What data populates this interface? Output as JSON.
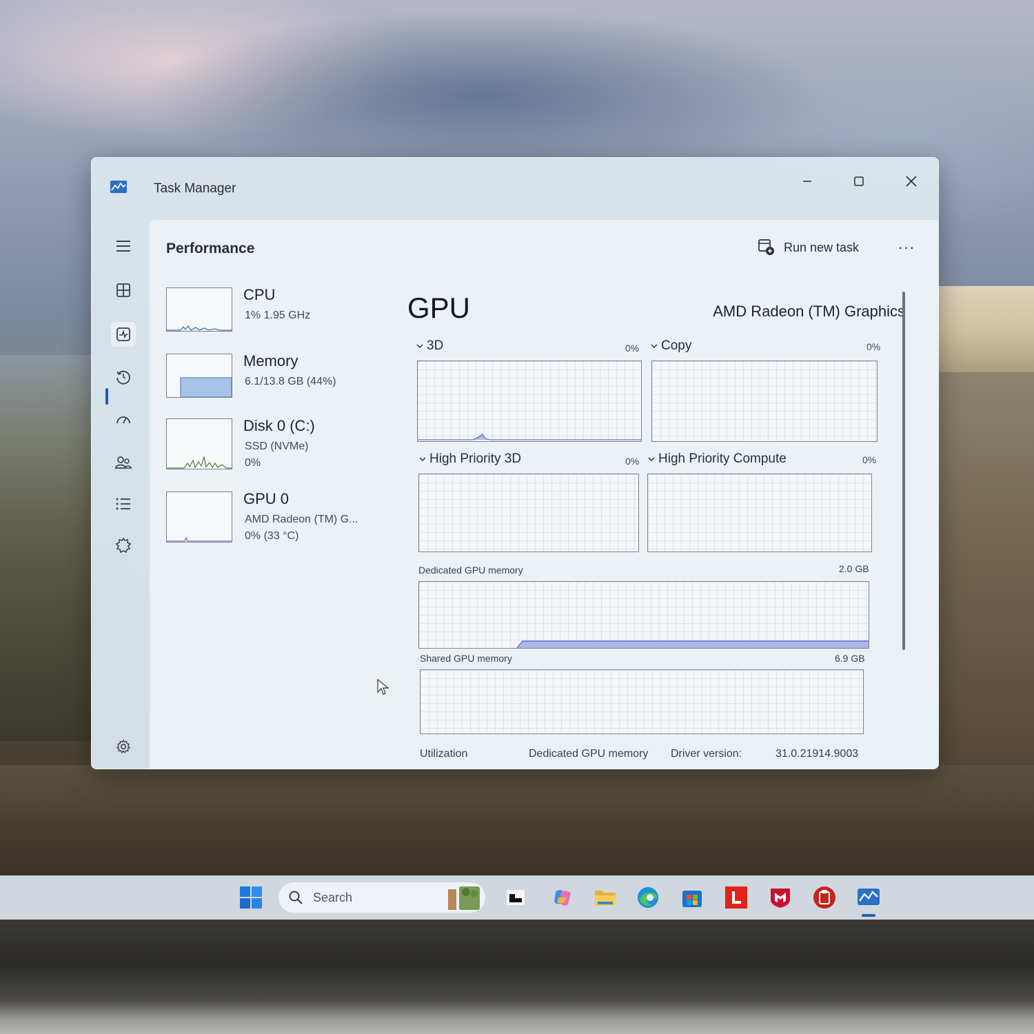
{
  "window": {
    "title": "Task Manager",
    "minimize_label": "",
    "maximize_label": "",
    "close_label": ""
  },
  "nav": {
    "items": [
      {
        "name": "menu-icon"
      },
      {
        "name": "processes-icon"
      },
      {
        "name": "performance-icon",
        "active": true
      },
      {
        "name": "app-history-icon"
      },
      {
        "name": "startup-apps-icon"
      },
      {
        "name": "users-icon"
      },
      {
        "name": "details-icon"
      },
      {
        "name": "services-icon"
      },
      {
        "name": "settings-icon"
      }
    ]
  },
  "header": {
    "page_title": "Performance",
    "run_new_task": "Run new task",
    "more": "···"
  },
  "devices": [
    {
      "name": "CPU",
      "line1": "1%  1.95 GHz",
      "line2": ""
    },
    {
      "name": "Memory",
      "line1": "6.1/13.8 GB (44%)",
      "line2": ""
    },
    {
      "name": "Disk 0 (C:)",
      "line1": "SSD (NVMe)",
      "line2": "0%"
    },
    {
      "name": "GPU 0",
      "line1": "AMD Radeon (TM) G...",
      "line2": "0%  (33 °C)"
    }
  ],
  "gpu": {
    "title": "GPU",
    "model": "AMD Radeon (TM) Graphics",
    "engines": [
      {
        "label": "3D",
        "percent": "0%"
      },
      {
        "label": "Copy",
        "percent": "0%"
      },
      {
        "label": "High Priority 3D",
        "percent": "0%"
      },
      {
        "label": "High Priority Compute",
        "percent": "0%"
      }
    ],
    "dedicated_memory": {
      "label": "Dedicated GPU memory",
      "max": "2.0 GB"
    },
    "shared_memory": {
      "label": "Shared GPU memory",
      "max": "6.9 GB"
    },
    "stats": {
      "utilization_label": "Utilization",
      "dedicated_label": "Dedicated GPU memory",
      "driver_label": "Driver version:",
      "driver_value": "31.0.21914.9003"
    }
  },
  "taskbar": {
    "search_placeholder": "Search",
    "icons": [
      "start-icon",
      "search-icon",
      "widgets-icon",
      "task-view-icon",
      "copilot-icon",
      "file-explorer-icon",
      "edge-icon",
      "store-icon",
      "lenovo-icon",
      "mcafee-icon",
      "office-icon",
      "task-manager-icon"
    ]
  },
  "colors": {
    "accent": "#1a5fb4",
    "graph_line": "#6a6fd0",
    "graph_fill": "#aab8e8"
  }
}
